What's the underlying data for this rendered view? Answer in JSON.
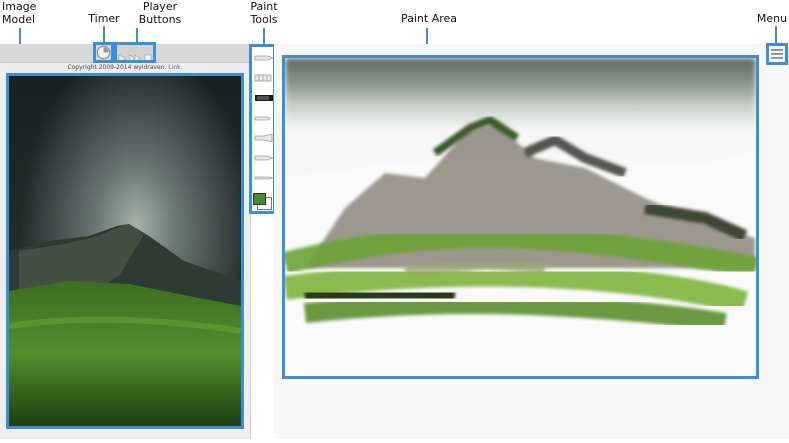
{
  "callouts": {
    "image_model": "Image\nModel",
    "timer": "Timer",
    "player_buttons": "Player\nButtons",
    "paint_tools": "Paint\nTools",
    "paint_area": "Paint Area",
    "menu": "Menu"
  },
  "copyright": {
    "text": "Copyright 2009-2014 wyldraven.",
    "link": "Link."
  },
  "tools": [
    "pencil-icon",
    "marker-icon",
    "wide-brush-icon",
    "round-brush-icon",
    "flat-brush-icon",
    "fan-brush-icon",
    "thin-brush-icon",
    "color-swatch-icon"
  ],
  "colors": {
    "accent": "#3b8fd6",
    "swatch_front": "#4a8a2e",
    "swatch_back": "#ffffff"
  }
}
